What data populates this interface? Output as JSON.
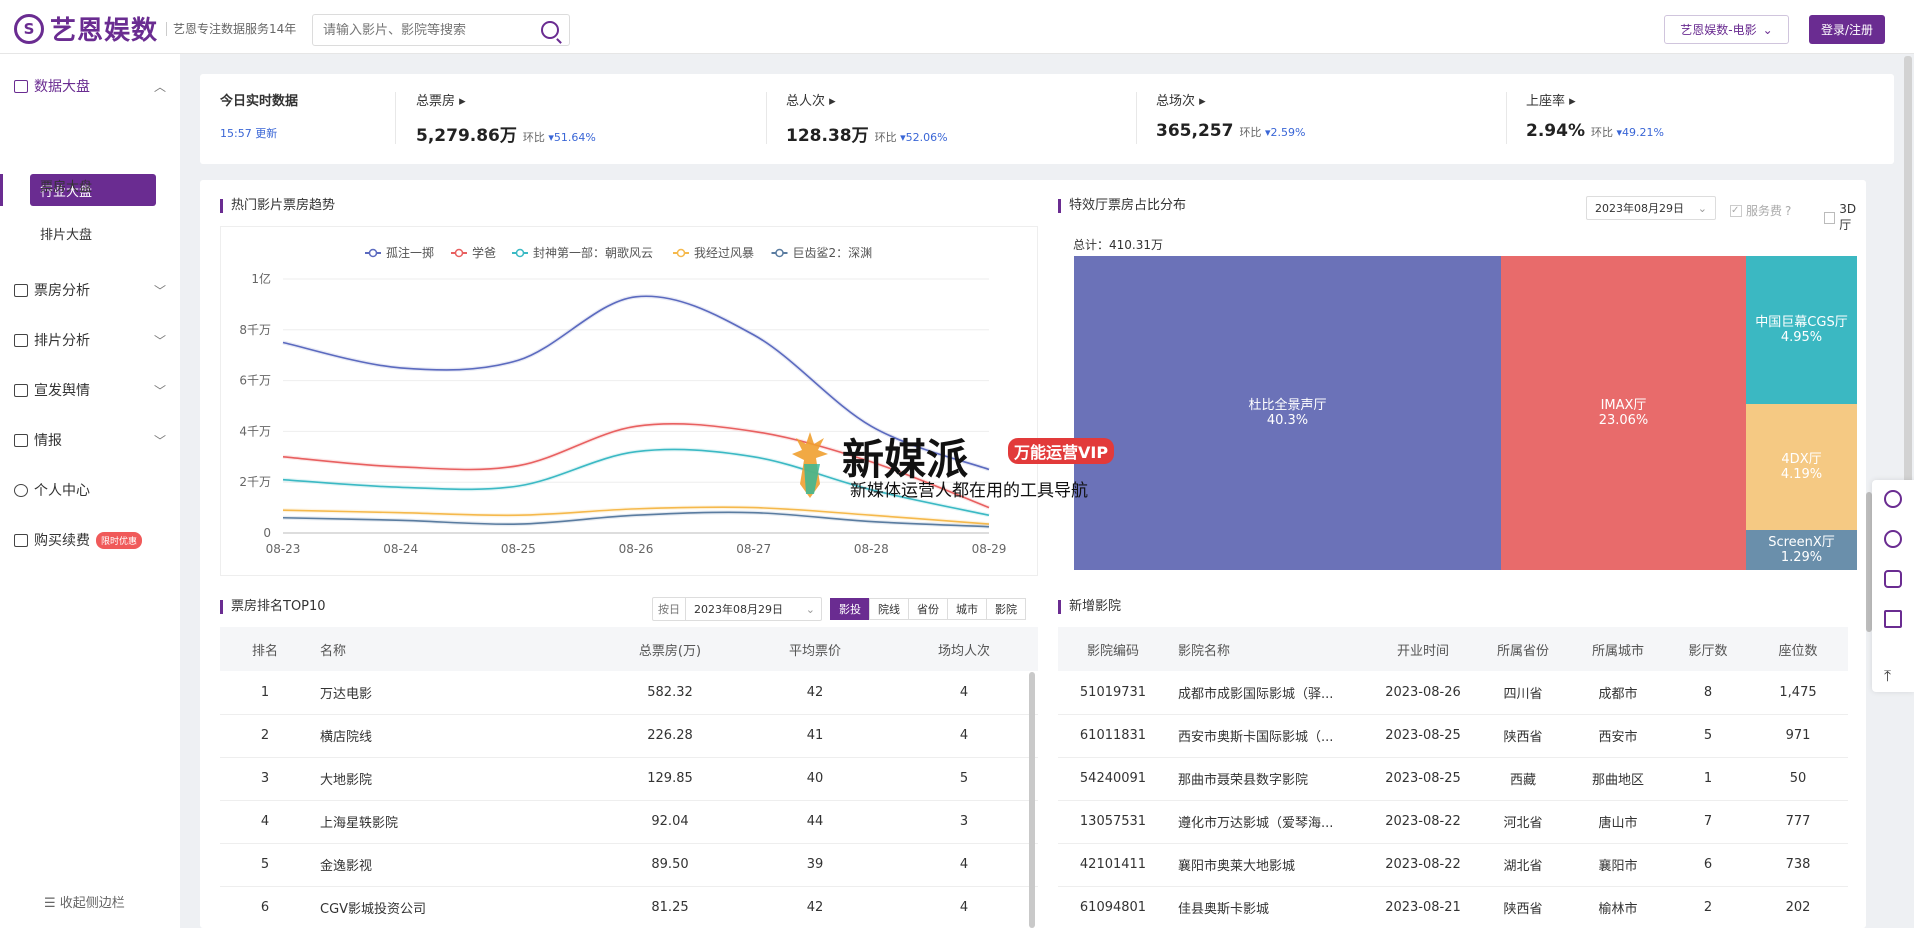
{
  "header": {
    "logo_glyph": "S",
    "brand": "艺恩娱数",
    "tagline": "艺恩专注数据服务14年",
    "search_placeholder": "请输入影片、影院等搜索",
    "product": "艺恩娱数-电影",
    "login": "登录/注册"
  },
  "sidebar": {
    "items": [
      {
        "label": "数据大盘"
      },
      {
        "label": "票房分析"
      },
      {
        "label": "排片分析"
      },
      {
        "label": "宣发舆情"
      },
      {
        "label": "情报"
      },
      {
        "label": "个人中心"
      },
      {
        "label": "购买续费"
      }
    ],
    "sub": [
      "行业大盘",
      "票房大盘",
      "排片大盘"
    ],
    "badge": "限时优惠",
    "collapse": "收起侧边栏"
  },
  "realtime": {
    "title": "今日实时数据",
    "update": "15:57 更新",
    "cmp_label": "环比",
    "stats": [
      {
        "label": "总票房",
        "value": "5,279.86万",
        "change": "51.64%"
      },
      {
        "label": "总人次",
        "value": "128.38万",
        "change": "52.06%"
      },
      {
        "label": "总场次",
        "value": "365,257",
        "change": "2.59%"
      },
      {
        "label": "上座率",
        "value": "2.94%",
        "change": "49.21%"
      }
    ]
  },
  "trend": {
    "title": "热门影片票房趋势"
  },
  "chart_data": {
    "type": "line",
    "x": [
      "08-23",
      "08-24",
      "08-25",
      "08-26",
      "08-27",
      "08-28",
      "08-29"
    ],
    "yticks": [
      "0",
      "2千万",
      "4千万",
      "6千万",
      "8千万",
      "1亿"
    ],
    "ylim": [
      0,
      10000
    ],
    "yunit": "万",
    "series": [
      {
        "name": "孤注一掷",
        "color": "#5b6abf",
        "values": [
          7500,
          6500,
          6800,
          9300,
          7800,
          4200,
          2500
        ]
      },
      {
        "name": "学爸",
        "color": "#e86060",
        "values": [
          3000,
          2600,
          2650,
          4200,
          4000,
          2800,
          1000
        ]
      },
      {
        "name": "封神第一部：朝歌风云",
        "color": "#3bb9c4",
        "values": [
          2100,
          1800,
          1850,
          3200,
          3000,
          1700,
          700
        ]
      },
      {
        "name": "我经过风暴",
        "color": "#f5b94c",
        "values": [
          900,
          800,
          700,
          950,
          1000,
          700,
          350
        ]
      },
      {
        "name": "巨齿鲨2：深渊",
        "color": "#5a7ca0",
        "values": [
          600,
          500,
          350,
          700,
          800,
          450,
          250
        ]
      }
    ]
  },
  "special_hall": {
    "title": "特效厅票房占比分布",
    "date": "2023年08月29日",
    "service_fee": "服务费",
    "hall3d": "3D厅",
    "total": "总计：410.31万",
    "cells": [
      {
        "name": "杜比全景声厅",
        "pct": "40.3%",
        "color": "#6b72b8"
      },
      {
        "name": "IMAX厅",
        "pct": "23.06%",
        "color": "#e86b6b"
      },
      {
        "name": "中国巨幕CGS厅",
        "pct": "4.95%",
        "color": "#3bb8c2"
      },
      {
        "name": "4DX厅",
        "pct": "4.19%",
        "color": "#f5c983"
      },
      {
        "name": "ScreenX厅",
        "pct": "1.29%",
        "color": "#6a8fab"
      }
    ]
  },
  "top10": {
    "title": "票房排名TOP10",
    "by": "按日",
    "date": "2023年08月29日",
    "tabs": [
      "影投",
      "院线",
      "省份",
      "城市",
      "影院"
    ],
    "cols": [
      "排名",
      "名称",
      "总票房(万)",
      "平均票价",
      "场均人次"
    ],
    "rows": [
      [
        "1",
        "万达电影",
        "582.32",
        "42",
        "4"
      ],
      [
        "2",
        "横店院线",
        "226.28",
        "41",
        "4"
      ],
      [
        "3",
        "大地影院",
        "129.85",
        "40",
        "5"
      ],
      [
        "4",
        "上海星轶影院",
        "92.04",
        "44",
        "3"
      ],
      [
        "5",
        "金逸影视",
        "89.50",
        "39",
        "4"
      ],
      [
        "6",
        "CGV影城投资公司",
        "81.25",
        "42",
        "4"
      ]
    ]
  },
  "new_cinema": {
    "title": "新增影院",
    "cols": [
      "影院编码",
      "影院名称",
      "开业时间",
      "所属省份",
      "所属城市",
      "影厅数",
      "座位数"
    ],
    "rows": [
      [
        "51019731",
        "成都市成影国际影城（驿...",
        "2023-08-26",
        "四川省",
        "成都市",
        "8",
        "1,475"
      ],
      [
        "61011831",
        "西安市奥斯卡国际影城（...",
        "2023-08-25",
        "陕西省",
        "西安市",
        "5",
        "971"
      ],
      [
        "54240091",
        "那曲市聂荣县数字影院",
        "2023-08-25",
        "西藏",
        "那曲地区",
        "1",
        "50"
      ],
      [
        "13057531",
        "遵化市万达影城（爱琴海...",
        "2023-08-22",
        "河北省",
        "唐山市",
        "7",
        "777"
      ],
      [
        "42101411",
        "襄阳市奥莱大地影城",
        "2023-08-22",
        "湖北省",
        "襄阳市",
        "6",
        "738"
      ],
      [
        "61094801",
        "佳县奥斯卡影城",
        "2023-08-21",
        "陕西省",
        "榆林市",
        "2",
        "202"
      ]
    ]
  },
  "watermark": {
    "brand": "新媒派",
    "vip": "万能运营VIP",
    "slogan": "新媒体运营人都在用的工具导航"
  }
}
